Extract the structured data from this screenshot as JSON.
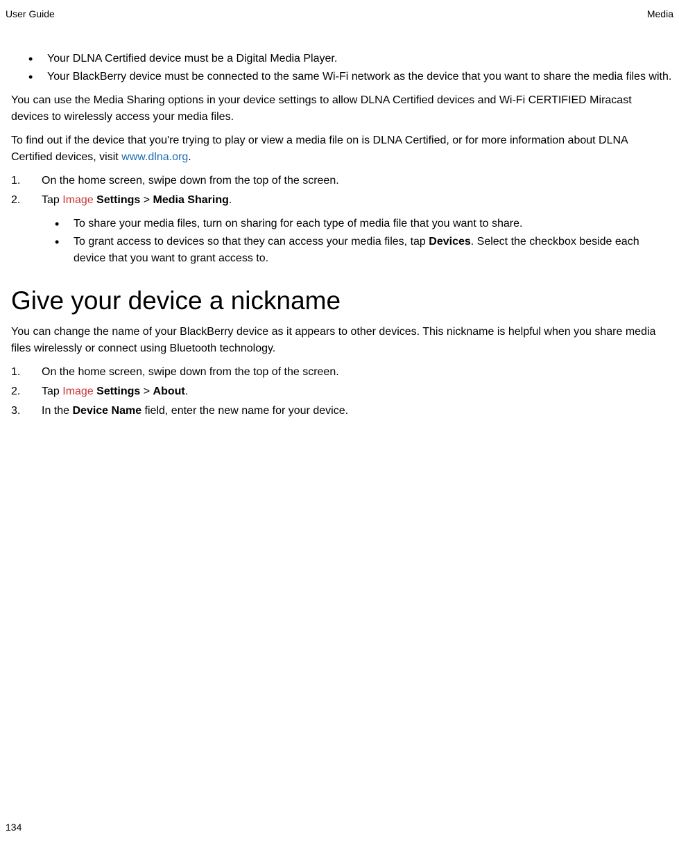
{
  "header": {
    "left": "User Guide",
    "right": "Media"
  },
  "intro_bullets": {
    "b1": "Your DLNA Certified device must be a Digital Media Player.",
    "b2": "Your BlackBerry device must be connected to the same Wi-Fi network as the device that you want to share the media files with."
  },
  "para1": "You can use the Media Sharing options in your device settings to allow DLNA Certified devices and Wi-Fi CERTIFIED Miracast devices to wirelessly access your media files.",
  "para2_pre": "To find out if the device that you're trying to play or view a media file on is DLNA Certified, or for more information about DLNA Certified devices, visit ",
  "para2_link": "www.dlna.org",
  "para2_post": ".",
  "steps1": {
    "s1": "On the home screen, swipe down from the top of the screen.",
    "s2_pre": "Tap ",
    "s2_img": "Image",
    "s2_settings": " Settings",
    "s2_gt": " > ",
    "s2_media": "Media Sharing",
    "s2_post": "."
  },
  "nested": {
    "n1": "To share your media files, turn on sharing for each type of media file that you want to share.",
    "n2_pre": "To grant access to devices so that they can access your media files, tap ",
    "n2_devices": "Devices",
    "n2_post": ". Select the checkbox beside each device that you want to grant access to."
  },
  "heading": "Give your device a nickname",
  "para3": "You can change the name of your BlackBerry device as it appears to other devices. This nickname is helpful when you share media files wirelessly or connect using Bluetooth technology.",
  "steps2": {
    "s1": "On the home screen, swipe down from the top of the screen.",
    "s2_pre": "Tap ",
    "s2_img": "Image",
    "s2_settings": " Settings",
    "s2_gt": " > ",
    "s2_about": "About",
    "s2_post": ".",
    "s3_pre": "In the ",
    "s3_device": "Device Name",
    "s3_post": " field, enter the new name for your device."
  },
  "page_number": "134"
}
